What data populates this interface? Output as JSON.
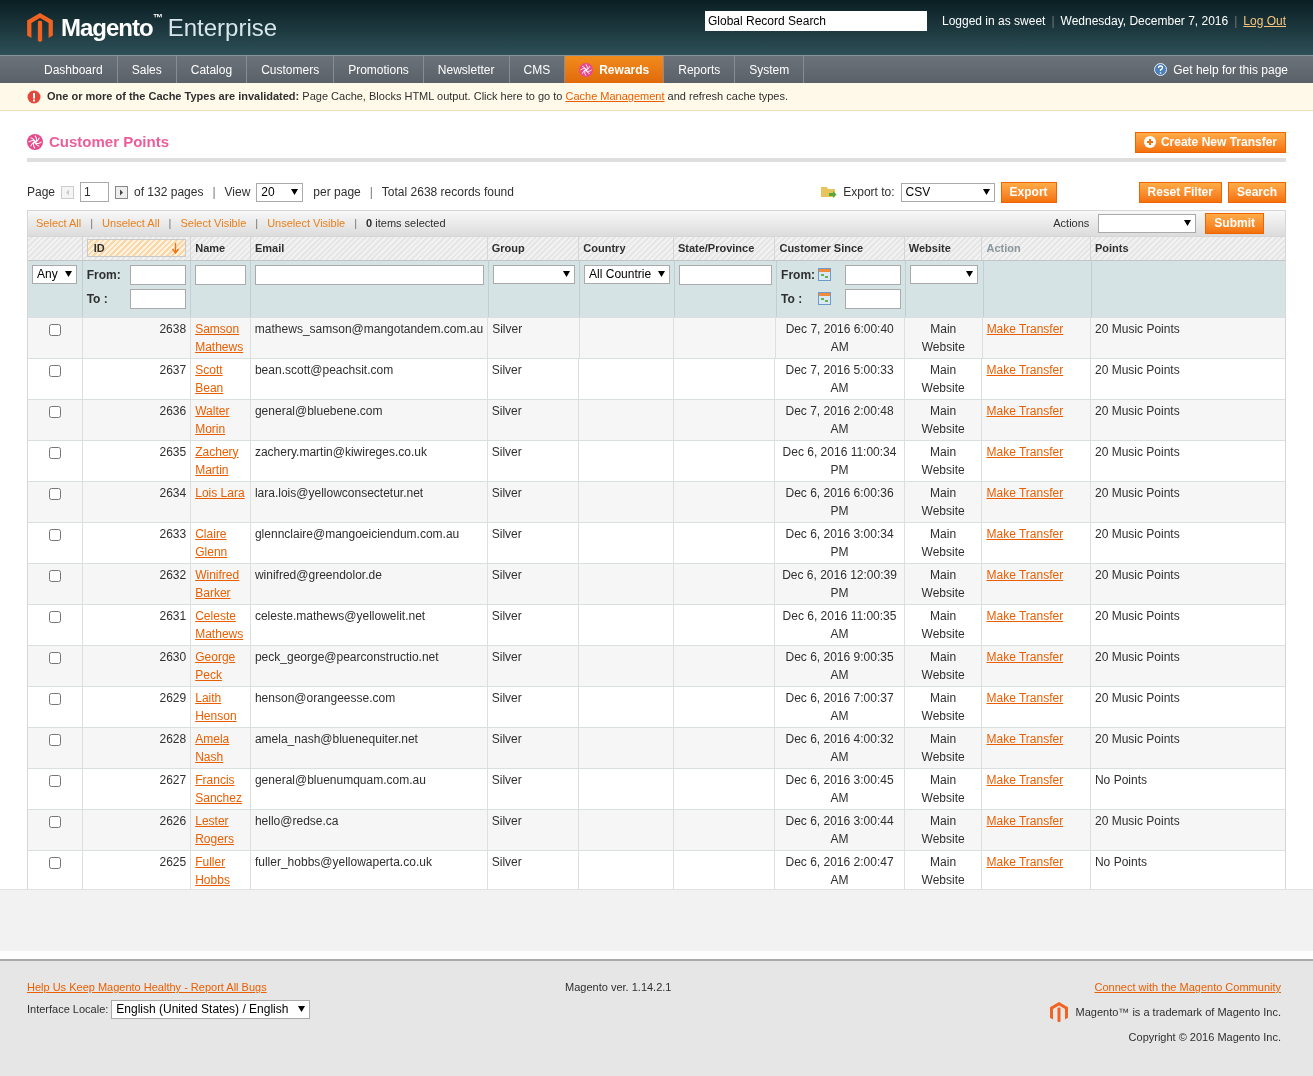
{
  "header": {
    "logo_name": "Magento",
    "logo_tm": "™",
    "logo_edition": "Enterprise",
    "search": {
      "value": "Global Record Search"
    },
    "user": "Logged in as sweet",
    "date": "Wednesday, December 7, 2016",
    "logout": "Log Out",
    "separators": [
      "|",
      "|"
    ]
  },
  "nav": [
    {
      "label": "Dashboard",
      "selected": false
    },
    {
      "label": "Sales",
      "selected": false
    },
    {
      "label": "Catalog",
      "selected": false
    },
    {
      "label": "Customers",
      "selected": false
    },
    {
      "label": "Promotions",
      "selected": false
    },
    {
      "label": "Newsletter",
      "selected": false
    },
    {
      "label": "CMS",
      "selected": false
    },
    {
      "label": "Rewards",
      "selected": true
    },
    {
      "label": "Reports",
      "selected": false
    },
    {
      "label": "System",
      "selected": false
    }
  ],
  "help": "Get help for this page",
  "notice": {
    "bold": "One or more of the Cache Types are invalidated:",
    "text": "Page Cache, Blocks HTML output. Click here to go to",
    "link": "Cache Management",
    "after": "and refresh cache types."
  },
  "page_title": "Customer Points",
  "create_button": "Create New Transfer",
  "pager": {
    "page_label": "Page",
    "page": "1",
    "of_pages": "of 132 pages",
    "view_label": "View",
    "per_page": "20",
    "per_page_label": "per page",
    "total": "Total 2638 records found",
    "separators": [
      "|",
      "|"
    ],
    "export_label": "Export to:",
    "export_format": "CSV",
    "export_button": "Export",
    "reset_button": "Reset Filter",
    "search_button": "Search"
  },
  "massaction": {
    "links": [
      "Select All",
      "Unselect All",
      "Select Visible",
      "Unselect Visible"
    ],
    "separators": [
      "|",
      "|",
      "|",
      "|"
    ],
    "count": "0",
    "count_label": "items selected",
    "actions_label": "Actions",
    "submit": "Submit"
  },
  "columns": [
    {
      "label": "ID",
      "sorted": true,
      "sortable": true
    },
    {
      "label": "Name",
      "sorted": false,
      "sortable": true
    },
    {
      "label": "Email",
      "sorted": false,
      "sortable": true
    },
    {
      "label": "Group",
      "sorted": false,
      "sortable": true
    },
    {
      "label": "Country",
      "sorted": false,
      "sortable": true
    },
    {
      "label": "State/Province",
      "sorted": false,
      "sortable": true
    },
    {
      "label": "Customer Since",
      "sorted": false,
      "sortable": true
    },
    {
      "label": "Website",
      "sorted": false,
      "sortable": true
    },
    {
      "label": "Action",
      "sorted": false,
      "sortable": false
    },
    {
      "label": "Points",
      "sorted": false,
      "sortable": true
    }
  ],
  "filters": {
    "any": "Any",
    "id_from": "From:",
    "id_to": "To :",
    "country": "All Countrie",
    "since_from": "From:",
    "since_to": "To :"
  },
  "rows": [
    {
      "checked": false,
      "id": "2638",
      "name": "Samson Mathews",
      "email": "mathews_samson@mangotandem.com.au",
      "group": "Silver",
      "since": "Dec 7, 2016 6:00:40 AM",
      "website": "Main Website",
      "action": "Make Transfer",
      "points": "20 Music Points"
    },
    {
      "checked": false,
      "id": "2637",
      "name": "Scott Bean",
      "email": "bean.scott@peachsit.com",
      "group": "Silver",
      "since": "Dec 7, 2016 5:00:33 AM",
      "website": "Main Website",
      "action": "Make Transfer",
      "points": "20 Music Points"
    },
    {
      "checked": false,
      "id": "2636",
      "name": "Walter Morin",
      "email": "general@bluebene.com",
      "group": "Silver",
      "since": "Dec 7, 2016 2:00:48 AM",
      "website": "Main Website",
      "action": "Make Transfer",
      "points": "20 Music Points"
    },
    {
      "checked": false,
      "id": "2635",
      "name": "Zachery Martin",
      "email": "zachery.martin@kiwireges.co.uk",
      "group": "Silver",
      "since": "Dec 6, 2016 11:00:34 PM",
      "website": "Main Website",
      "action": "Make Transfer",
      "points": "20 Music Points"
    },
    {
      "checked": false,
      "id": "2634",
      "name": "Lois Lara",
      "email": "lara.lois@yellowconsectetur.net",
      "group": "Silver",
      "since": "Dec 6, 2016 6:00:36 PM",
      "website": "Main Website",
      "action": "Make Transfer",
      "points": "20 Music Points"
    },
    {
      "checked": false,
      "id": "2633",
      "name": "Claire Glenn",
      "email": "glennclaire@mangoeiciendum.com.au",
      "group": "Silver",
      "since": "Dec 6, 2016 3:00:34 PM",
      "website": "Main Website",
      "action": "Make Transfer",
      "points": "20 Music Points"
    },
    {
      "checked": false,
      "id": "2632",
      "name": "Winifred Barker",
      "email": "winifred@greendolor.de",
      "group": "Silver",
      "since": "Dec 6, 2016 12:00:39 PM",
      "website": "Main Website",
      "action": "Make Transfer",
      "points": "20 Music Points"
    },
    {
      "checked": false,
      "id": "2631",
      "name": "Celeste Mathews",
      "email": "celeste.mathews@yellowelit.net",
      "group": "Silver",
      "since": "Dec 6, 2016 11:00:35 AM",
      "website": "Main Website",
      "action": "Make Transfer",
      "points": "20 Music Points"
    },
    {
      "checked": false,
      "id": "2630",
      "name": "George Peck",
      "email": "peck_george@pearconstructio.net",
      "group": "Silver",
      "since": "Dec 6, 2016 9:00:35 AM",
      "website": "Main Website",
      "action": "Make Transfer",
      "points": "20 Music Points"
    },
    {
      "checked": false,
      "id": "2629",
      "name": "Laith Henson",
      "email": "henson@orangeesse.com",
      "group": "Silver",
      "since": "Dec 6, 2016 7:00:37 AM",
      "website": "Main Website",
      "action": "Make Transfer",
      "points": "20 Music Points"
    },
    {
      "checked": false,
      "id": "2628",
      "name": "Amela Nash",
      "email": "amela_nash@bluenequiter.net",
      "group": "Silver",
      "since": "Dec 6, 2016 4:00:32 AM",
      "website": "Main Website",
      "action": "Make Transfer",
      "points": "20 Music Points"
    },
    {
      "checked": false,
      "id": "2627",
      "name": "Francis Sanchez",
      "email": "general@bluenumquam.com.au",
      "group": "Silver",
      "since": "Dec 6, 2016 3:00:45 AM",
      "website": "Main Website",
      "action": "Make Transfer",
      "points": "No Points"
    },
    {
      "checked": false,
      "id": "2626",
      "name": "Lester Rogers",
      "email": "hello@redse.ca",
      "group": "Silver",
      "since": "Dec 6, 2016 3:00:44 AM",
      "website": "Main Website",
      "action": "Make Transfer",
      "points": "20 Music Points"
    },
    {
      "checked": false,
      "id": "2625",
      "name": "Fuller Hobbs",
      "email": "fuller_hobbs@yellowaperta.co.uk",
      "group": "Silver",
      "since": "Dec 6, 2016 2:00:47 AM",
      "website": "Main Website",
      "action": "Make Transfer",
      "points": "No Points"
    }
  ],
  "footer": {
    "bugs_link": "Help Us Keep Magento Healthy - Report All Bugs",
    "locale_label": "Interface Locale:",
    "locale": "English (United States) / English",
    "version": "Magento ver. 1.14.2.1",
    "community_link": "Connect with the Magento Community",
    "trademark": "Magento™ is a trademark of Magento Inc.",
    "copyright": "Copyright © 2016 Magento Inc."
  }
}
